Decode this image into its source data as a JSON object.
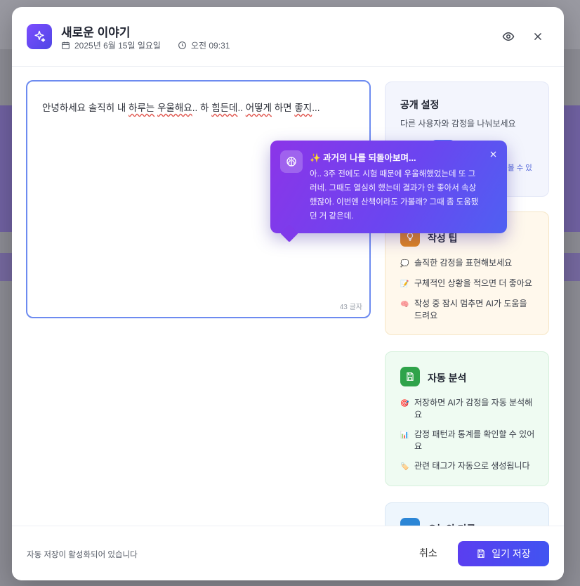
{
  "modal": {
    "title": "새로운 이야기",
    "date": "2025년 6월 15일 일요일",
    "time": "오전 09:31"
  },
  "editor": {
    "text_before": "안녕하세요 솔직히 내 ",
    "text_err1": "하루는",
    "text_mid1": " ",
    "text_err2": "우울해요",
    "text_mid2": ".. 하 ",
    "text_err3": "힘든데",
    "text_mid3": ".. ",
    "text_err4": "어떻게",
    "text_mid4": " 하면 ",
    "text_err5": "좋지",
    "text_after": "...",
    "char_count": "43 글자"
  },
  "popover": {
    "title": "과거의 나를 되돌아보며...",
    "body": "아.. 3주 전에도 시험 때문에 우울해했었는데 또 그러네. 그때도 열심히 했는데 결과가 안 좋아서 속상했잖아. 이번엔 산책이라도 가볼래? 그때 좀 도움됐던 거 같은데."
  },
  "cards": {
    "public": {
      "title": "공개 설정",
      "subtitle": "다른 사용자와 감정을 나눠보세요",
      "partial_text": "볼 수 있"
    },
    "tips": {
      "title": "작성 팁",
      "items": [
        {
          "emoji": "💭",
          "text": "솔직한 감정을 표현해보세요"
        },
        {
          "emoji": "📝",
          "text": "구체적인 상황을 적으면 더 좋아요"
        },
        {
          "emoji": "🧠",
          "text": "작성 중 잠시 멈추면 AI가 도움을 드려요"
        }
      ]
    },
    "auto": {
      "title": "자동 분석",
      "items": [
        {
          "emoji": "🎯",
          "text": "저장하면 AI가 감정을 자동 분석해요"
        },
        {
          "emoji": "📊",
          "text": "감정 패턴과 통계를 확인할 수 있어요"
        },
        {
          "emoji": "🏷️",
          "text": "관련 태그가 자동으로 생성됩니다"
        }
      ]
    },
    "today": {
      "title": "오늘의 기록"
    }
  },
  "footer": {
    "autosave": "자동 저장이 활성화되어 있습니다",
    "cancel": "취소",
    "save": "일기 저장"
  },
  "colors": {
    "accent": "#5a3ef0",
    "tips_icon": "#e0851f",
    "auto_icon": "#2fa34a",
    "today_icon": "#2c86d6"
  }
}
